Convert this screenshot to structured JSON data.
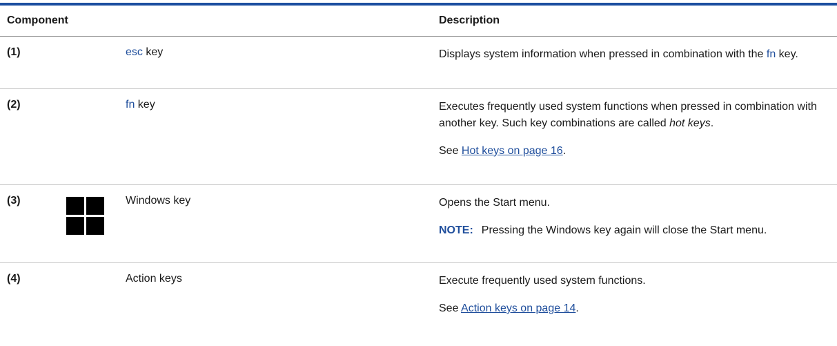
{
  "table": {
    "headers": {
      "component": "Component",
      "description": "Description"
    },
    "rows": [
      {
        "number": "(1)",
        "name_key": "esc",
        "name_suffix": "key",
        "desc_line1_pre": "Displays system information when pressed in combination with the ",
        "desc_line1_kw": "fn",
        "desc_line1_post": " key."
      },
      {
        "number": "(2)",
        "name_key": "fn",
        "name_suffix": "key",
        "desc_pre": "Executes frequently used system functions when pressed in combination with another key. Such key combinations are called ",
        "desc_em": "hot keys",
        "desc_post": ".",
        "see_prefix": "See ",
        "see_link": "Hot keys on page 16",
        "see_suffix": "."
      },
      {
        "number": "(3)",
        "icon": "windows-logo-icon",
        "name": "Windows key",
        "desc": "Opens the Start menu.",
        "note_label": "NOTE:",
        "note_text": "Pressing the Windows key again will close the Start menu."
      },
      {
        "number": "(4)",
        "name": "Action keys",
        "desc": "Execute frequently used system functions.",
        "see_prefix": "See ",
        "see_link": "Action keys on page 14",
        "see_suffix": "."
      }
    ]
  },
  "colors": {
    "rule": "#1c4ea0",
    "keyword": "#1f4e9c",
    "note": "#1f4e9c"
  }
}
